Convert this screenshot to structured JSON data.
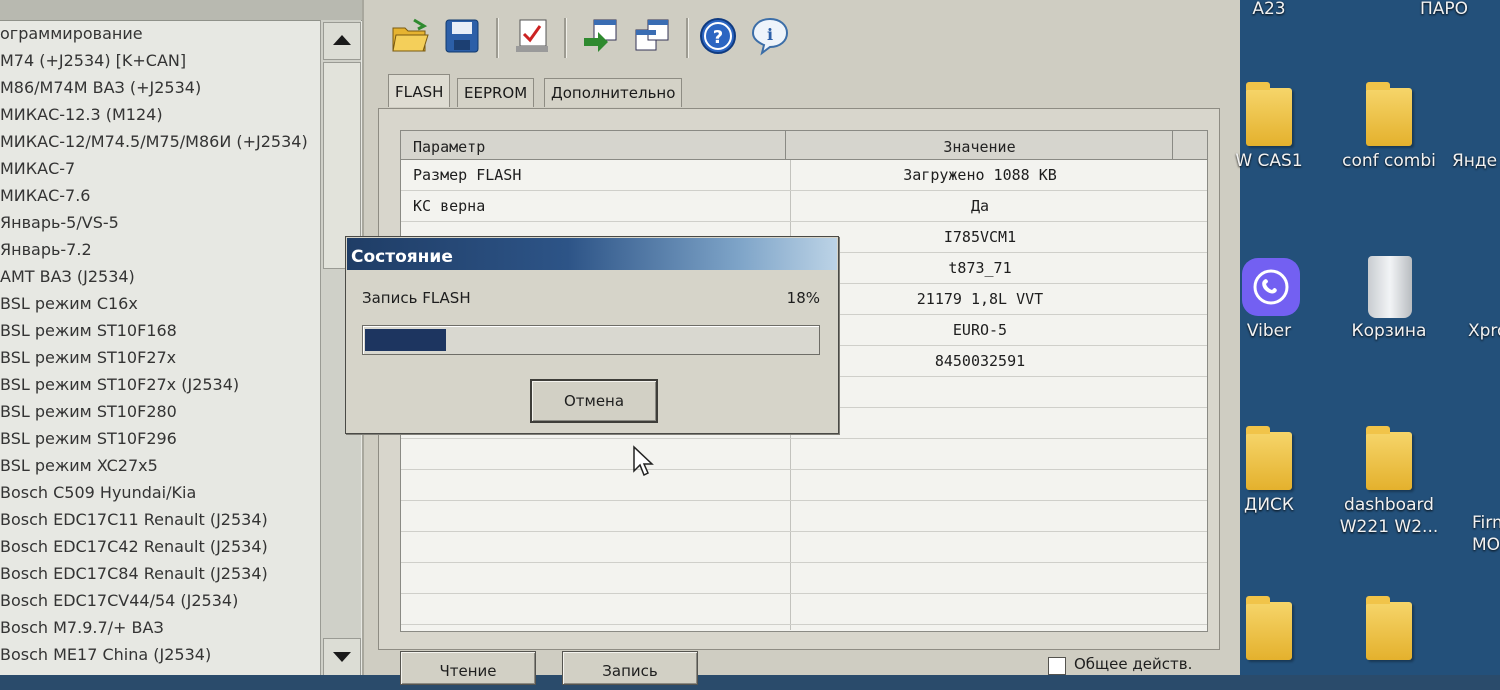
{
  "left_list": {
    "items": [
      "ограммирование",
      "M74 (+J2534) [K+CAN]",
      "M86/M74M ВАЗ (+J2534)",
      "МИКАС-12.3 (M124)",
      "МИКАС-12/M74.5/M75/M86И (+J2534)",
      "МИКАС-7",
      "МИКАС-7.6",
      "Январь-5/VS-5",
      "Январь-7.2",
      "AMT ВАЗ (J2534)",
      "BSL режим C16x",
      "BSL режим ST10F168",
      "BSL режим ST10F27x",
      "BSL режим ST10F27x (J2534)",
      "BSL режим ST10F280",
      "BSL режим ST10F296",
      "BSL режим XC27x5",
      "Bosch C509 Hyundai/Kia",
      "Bosch EDC17C11 Renault (J2534)",
      "Bosch EDC17C42 Renault (J2534)",
      "Bosch EDC17C84 Renault (J2534)",
      "Bosch EDC17CV44/54 (J2534)",
      "Bosch M7.9.7/+ ВАЗ",
      "Bosch ME17 China (J2534)"
    ]
  },
  "toolbar": {
    "icons": [
      "open-folder-icon",
      "save-disk-icon",
      "checklist-icon",
      "import-window-icon",
      "export-window-icon",
      "help-icon",
      "info-icon"
    ]
  },
  "tabs": [
    "FLASH",
    "EEPROM",
    "Дополнительно"
  ],
  "table": {
    "headers": {
      "param": "Параметр",
      "value": "Значение"
    },
    "rows": [
      {
        "param": "Размер FLASH",
        "value": "Загружено 1088 KB"
      },
      {
        "param": "КС верна",
        "value": "Да"
      },
      {
        "param": "",
        "value": "I785VCM1"
      },
      {
        "param": "",
        "value": "t873_71"
      },
      {
        "param": "",
        "value": "21179 1,8L VVT"
      },
      {
        "param": "",
        "value": "EURO-5"
      },
      {
        "param": "",
        "value": "8450032591"
      },
      {
        "param": "",
        "value": ""
      },
      {
        "param": "",
        "value": ""
      },
      {
        "param": "",
        "value": ""
      },
      {
        "param": "",
        "value": ""
      },
      {
        "param": "",
        "value": ""
      },
      {
        "param": "",
        "value": ""
      },
      {
        "param": "",
        "value": ""
      },
      {
        "param": "",
        "value": ""
      },
      {
        "param": "",
        "value": ""
      }
    ]
  },
  "buttons": {
    "read": "Чтение",
    "write": "Запись",
    "common_action": "Общее действ."
  },
  "dialog": {
    "title": "Состояние",
    "message": "Запись FLASH",
    "percent_label": "18%",
    "progress": 0.18,
    "cancel": "Отмена"
  },
  "desktop": {
    "icons": [
      {
        "label": "A23",
        "type": "text-only"
      },
      {
        "label": "ПАРО",
        "type": "text-only"
      },
      {
        "label": "W CAS1",
        "type": "folder"
      },
      {
        "label": "conf combi",
        "type": "folder"
      },
      {
        "label": "Янде",
        "type": "partial"
      },
      {
        "label": "Viber",
        "type": "viber"
      },
      {
        "label": "Корзина",
        "type": "recycle-bin"
      },
      {
        "label": "Xpro",
        "type": "partial"
      },
      {
        "label": "ДИСК",
        "type": "folder"
      },
      {
        "label": "dashboard W221 W2...",
        "type": "folder"
      },
      {
        "label": "Firm MO",
        "type": "partial"
      }
    ]
  },
  "colors": {
    "title_bar_start": "#1f3d66",
    "progress_fill": "#1d3560",
    "desktop_bg": "#23507a",
    "window_bg": "#cfcdc2"
  }
}
